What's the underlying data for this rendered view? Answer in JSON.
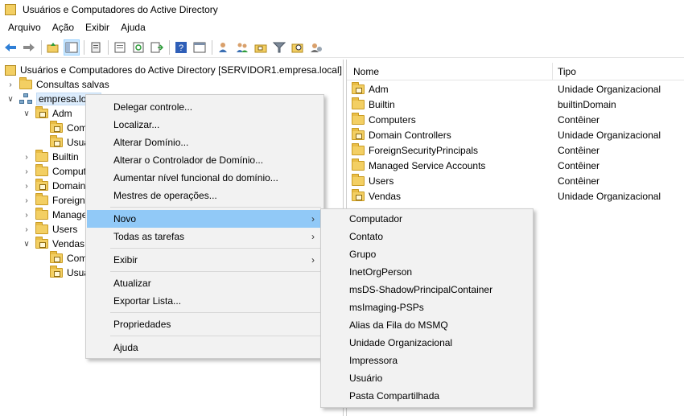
{
  "window": {
    "title": "Usuários e Computadores do Active Directory"
  },
  "menubar": [
    "Arquivo",
    "Ação",
    "Exibir",
    "Ajuda"
  ],
  "toolbar": {
    "icons": [
      "back-icon",
      "forward-icon",
      "up-folder-icon",
      "show-hide-console-tree-icon",
      "clipboard-icon",
      "properties-icon",
      "refresh-icon",
      "export-list-icon",
      "help-icon",
      "console-icon",
      "new-user-icon",
      "new-group-icon",
      "new-ou-icon",
      "filter-icon",
      "find-icon",
      "add-to-group-icon"
    ]
  },
  "tree": {
    "root": "Usuários e Computadores do Active Directory [SERVIDOR1.empresa.local]",
    "saved_queries": "Consultas salvas",
    "domain": "empresa.local",
    "adm": "Adm",
    "adm_child1": "Com",
    "adm_child2": "Usua",
    "builtin": "Builtin",
    "computers": "Comput",
    "domain_controllers": "Domain",
    "foreign": "ForeignS",
    "managed": "Manage",
    "users": "Users",
    "vendas": "Vendas",
    "vendas_child1": "Com",
    "vendas_child2": "Usua"
  },
  "list": {
    "col_name": "Nome",
    "col_type": "Tipo",
    "rows": [
      {
        "name": "Adm",
        "type": "Unidade Organizacional"
      },
      {
        "name": "Builtin",
        "type": "builtinDomain"
      },
      {
        "name": "Computers",
        "type": "Contêiner"
      },
      {
        "name": "Domain Controllers",
        "type": "Unidade Organizacional"
      },
      {
        "name": "ForeignSecurityPrincipals",
        "type": "Contêiner"
      },
      {
        "name": "Managed Service Accounts",
        "type": "Contêiner"
      },
      {
        "name": "Users",
        "type": "Contêiner"
      },
      {
        "name": "Vendas",
        "type": "Unidade Organizacional"
      }
    ]
  },
  "context_menu": {
    "delegate": "Delegar controle...",
    "find": "Localizar...",
    "change_domain": "Alterar Domínio...",
    "change_dc": "Alterar o Controlador de Domínio...",
    "raise_level": "Aumentar nível funcional do domínio...",
    "operations_masters": "Mestres de operações...",
    "new": "Novo",
    "all_tasks": "Todas as tarefas",
    "view": "Exibir",
    "refresh": "Atualizar",
    "export": "Exportar Lista...",
    "properties": "Propriedades",
    "help": "Ajuda"
  },
  "submenu": {
    "computer": "Computador",
    "contact": "Contato",
    "group": "Grupo",
    "inetorgperson": "InetOrgPerson",
    "shadow": "msDS-ShadowPrincipalContainer",
    "imaging": "msImaging-PSPs",
    "msmq": "Alias da Fila do MSMQ",
    "ou": "Unidade Organizacional",
    "printer": "Impressora",
    "user": "Usuário",
    "shared_folder": "Pasta Compartilhada"
  },
  "colors": {
    "highlight": "#91c9f7",
    "menu_bg": "#f2f2f2",
    "folder": "#f3cf63"
  }
}
